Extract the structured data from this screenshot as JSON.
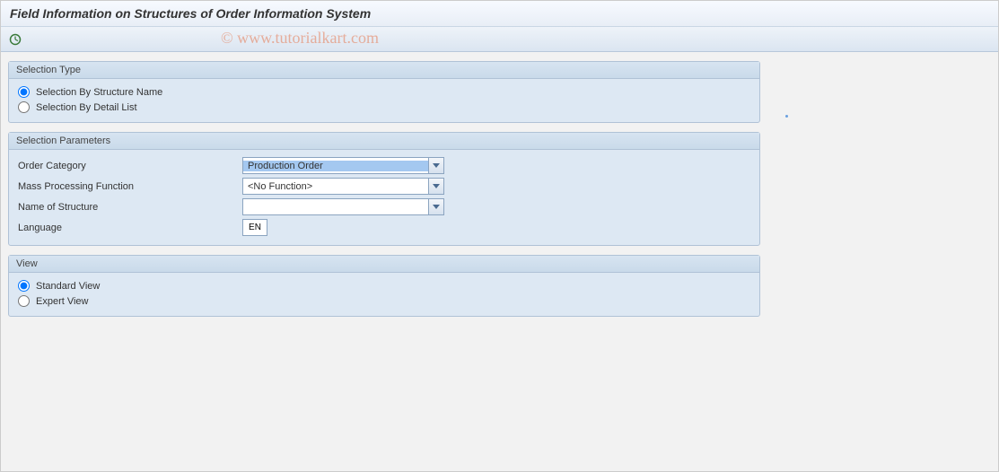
{
  "title": "Field Information on Structures of Order Information System",
  "watermark": "© www.tutorialkart.com",
  "icons": {
    "execute": "execute-clock-icon"
  },
  "panels": {
    "selectionType": {
      "title": "Selection Type",
      "options": [
        {
          "label": "Selection By Structure Name",
          "checked": true
        },
        {
          "label": "Selection By Detail List",
          "checked": false
        }
      ]
    },
    "selectionParams": {
      "title": "Selection Parameters",
      "rows": {
        "orderCategory": {
          "label": "Order Category",
          "value": "Production Order"
        },
        "massFunction": {
          "label": "Mass Processing Function",
          "value": "<No Function>"
        },
        "structureName": {
          "label": "Name of Structure",
          "value": ""
        },
        "language": {
          "label": "Language",
          "value": "EN"
        }
      }
    },
    "view": {
      "title": "View",
      "options": [
        {
          "label": "Standard View",
          "checked": true
        },
        {
          "label": "Expert View",
          "checked": false
        }
      ]
    }
  }
}
